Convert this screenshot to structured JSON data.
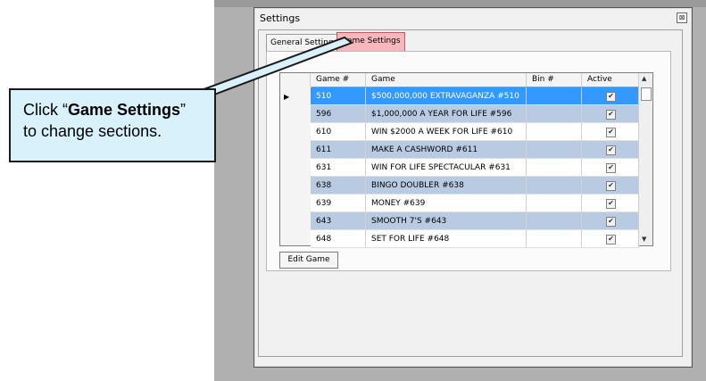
{
  "window": {
    "title": "Settings",
    "close_label": "⊠"
  },
  "tabs": [
    {
      "label": "General Settings"
    },
    {
      "label": "Game Settings"
    }
  ],
  "grid": {
    "headers": [
      "Game #",
      "Game",
      "Bin #",
      "Active"
    ],
    "rows": [
      {
        "num": "510",
        "game": "$500,000,000 EXTRAVAGANZA #510",
        "bin": "",
        "active": "✔"
      },
      {
        "num": "596",
        "game": "$1,000,000 A YEAR FOR LIFE #596",
        "bin": "",
        "active": "✔"
      },
      {
        "num": "610",
        "game": "WIN $2000 A WEEK FOR LIFE #610",
        "bin": "",
        "active": "✔"
      },
      {
        "num": "611",
        "game": "MAKE A CASHWORD #611",
        "bin": "",
        "active": "✔"
      },
      {
        "num": "631",
        "game": "WIN FOR LIFE SPECTACULAR #631",
        "bin": "",
        "active": "✔"
      },
      {
        "num": "638",
        "game": "BINGO DOUBLER #638",
        "bin": "",
        "active": "✔"
      },
      {
        "num": "639",
        "game": "MONEY #639",
        "bin": "",
        "active": "✔"
      },
      {
        "num": "643",
        "game": "SMOOTH 7'S #643",
        "bin": "",
        "active": "✔"
      },
      {
        "num": "648",
        "game": "SET FOR LIFE #648",
        "bin": "",
        "active": "✔"
      }
    ],
    "row_marker": "▶",
    "scroll_up": "▲",
    "scroll_down": "▼"
  },
  "buttons": {
    "edit_game": "Edit Game"
  },
  "callout": {
    "pre": "Click “",
    "bold": "Game Settings",
    "post": "” to change sections."
  },
  "colors": {
    "selected_row": "#3399ff",
    "alt_row": "#b9cbe3",
    "plain_row": "#ffffff",
    "highlight_tab": "#f7b8bd",
    "callout_bg": "#d8f1fb"
  }
}
